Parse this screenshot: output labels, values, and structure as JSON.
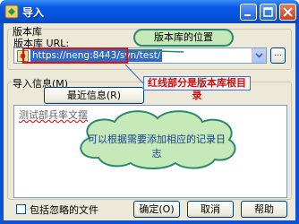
{
  "window": {
    "title": "导入",
    "controls": [
      "minimize",
      "maximize",
      "close"
    ]
  },
  "repository": {
    "group_label": "版本库",
    "url_label": "版本库 URL:",
    "url_value": "https://neng:8443/svn/test/",
    "browse_button": "..."
  },
  "import_message": {
    "group_label": "导入信息(M)",
    "recent_button": "最近信息(R)",
    "text": "测试部兵率文摆"
  },
  "footer": {
    "include_ignored_label": "包括忽略的文件",
    "include_ignored_checked": false,
    "ok_button": "确定(O)",
    "cancel_button": "取消",
    "help_button": "帮助"
  },
  "annotations": {
    "repo_location": "版本库的位置",
    "red_part_note": "红线部分是版本库根目录",
    "log_note": "可以根据需要添加相应的记录日志"
  },
  "colors": {
    "title_bar": "#0a5ae8",
    "dialog_bg": "#ece9d8",
    "highlight": "#316ac5",
    "red_mark": "#e01010",
    "callout_green": "#c5e9b8"
  }
}
